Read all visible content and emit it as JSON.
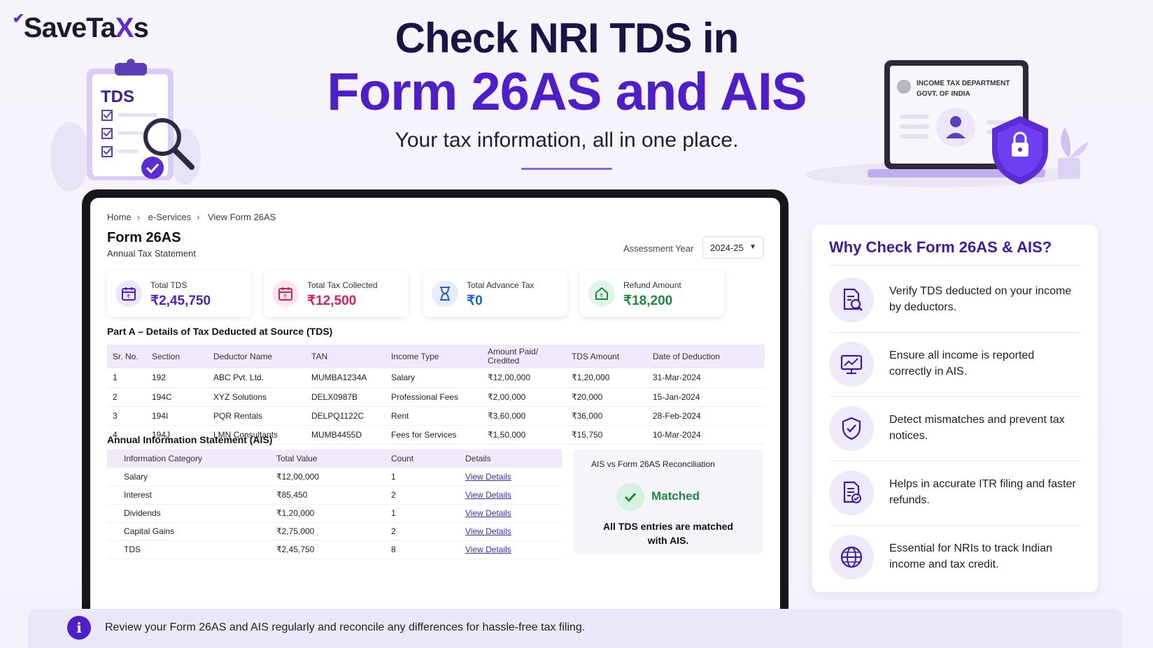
{
  "logo": {
    "text_a": "SaveTa",
    "text_x": "X",
    "text_b": "s"
  },
  "hero": {
    "line1": "Check NRI TDS in",
    "line2": "Form 26AS and AIS",
    "tagline": "Your tax information, all in one place."
  },
  "clipboard": {
    "label": "TDS"
  },
  "laptop_illu": {
    "line1": "INCOME TAX DEPARTMENT",
    "line2": "GOVT. OF INDIA"
  },
  "breadcrumb": [
    "Home",
    "e-Services",
    "View Form 26AS"
  ],
  "form": {
    "title": "Form 26AS",
    "subtitle": "Annual Tax Statement",
    "ay_label": "Assessment Year",
    "ay_value": "2024-25"
  },
  "cards": [
    {
      "label": "Total TDS",
      "value": "₹2,45,750",
      "color": "#4e1fc9",
      "icon": "calendar-rupee-icon"
    },
    {
      "label": "Total Tax Collected",
      "value": "₹12,500",
      "color": "#d91f5c",
      "icon": "calendar-receipt-icon"
    },
    {
      "label": "Total Advance Tax",
      "value": "₹0",
      "color": "#1f5fd9",
      "icon": "hourglass-icon"
    },
    {
      "label": "Refund Amount",
      "value": "₹18,200",
      "color": "#1e8a3e",
      "icon": "refund-home-icon"
    }
  ],
  "tds": {
    "title": "Part A – Details of Tax Deducted at Source (TDS)",
    "headers": [
      "Sr. No.",
      "Section",
      "Deductor Name",
      "TAN",
      "Income Type",
      "Amount Paid/ Credited",
      "TDS Amount",
      "Date of Deduction"
    ],
    "rows": [
      [
        "1",
        "192",
        "ABC Pvt. Ltd.",
        "MUMBA1234A",
        "Salary",
        "₹12,00,000",
        "₹1,20,000",
        "31-Mar-2024"
      ],
      [
        "2",
        "194C",
        "XYZ Solutions",
        "DELX0987B",
        "Professional Fees",
        "₹2,00,000",
        "₹20,000",
        "15-Jan-2024"
      ],
      [
        "3",
        "194I",
        "PQR Rentals",
        "DELPQ1122C",
        "Rent",
        "₹3,60,000",
        "₹36,000",
        "28-Feb-2024"
      ],
      [
        "4",
        "194J",
        "LMN Consultants",
        "MUMB4455D",
        "Fees for Services",
        "₹1,50,000",
        "₹15,750",
        "10-Mar-2024"
      ]
    ]
  },
  "ais": {
    "title": "Annual Information Statement (AIS)",
    "headers": [
      "Information Category",
      "Total Value",
      "Count",
      "Details"
    ],
    "rows": [
      [
        "Salary",
        "₹12,00,000",
        "1",
        "View Details"
      ],
      [
        "Interest",
        "₹85,450",
        "2",
        "View Details"
      ],
      [
        "Dividends",
        "₹1,20,000",
        "1",
        "View Details"
      ],
      [
        "Capital Gains",
        "₹2,75,000",
        "2",
        "View Details"
      ],
      [
        "TDS",
        "₹2,45,750",
        "8",
        "View Details"
      ]
    ]
  },
  "recon": {
    "title": "AIS vs Form 26AS Reconciliation",
    "status": "Matched",
    "note": "All TDS entries are matched with AIS."
  },
  "side": {
    "title": "Why Check Form 26AS & AIS?",
    "items": [
      {
        "text": "Verify TDS deducted on your income by deductors.",
        "icon": "document-search-icon"
      },
      {
        "text": "Ensure all income is reported correctly in AIS.",
        "icon": "monitor-chart-icon"
      },
      {
        "text": "Detect mismatches and prevent tax notices.",
        "icon": "shield-check-icon"
      },
      {
        "text": "Helps in accurate ITR filing and faster refunds.",
        "icon": "document-check-icon"
      },
      {
        "text": "Essential for NRIs to track Indian income and tax credit.",
        "icon": "globe-icon"
      }
    ]
  },
  "footer": {
    "text": "Review your Form 26AS and AIS regularly and reconcile any differences for hassle-free tax filing."
  },
  "colors": {
    "brand": "#4e1fc9",
    "navy": "#1a1446",
    "success": "#1e8a3e"
  }
}
